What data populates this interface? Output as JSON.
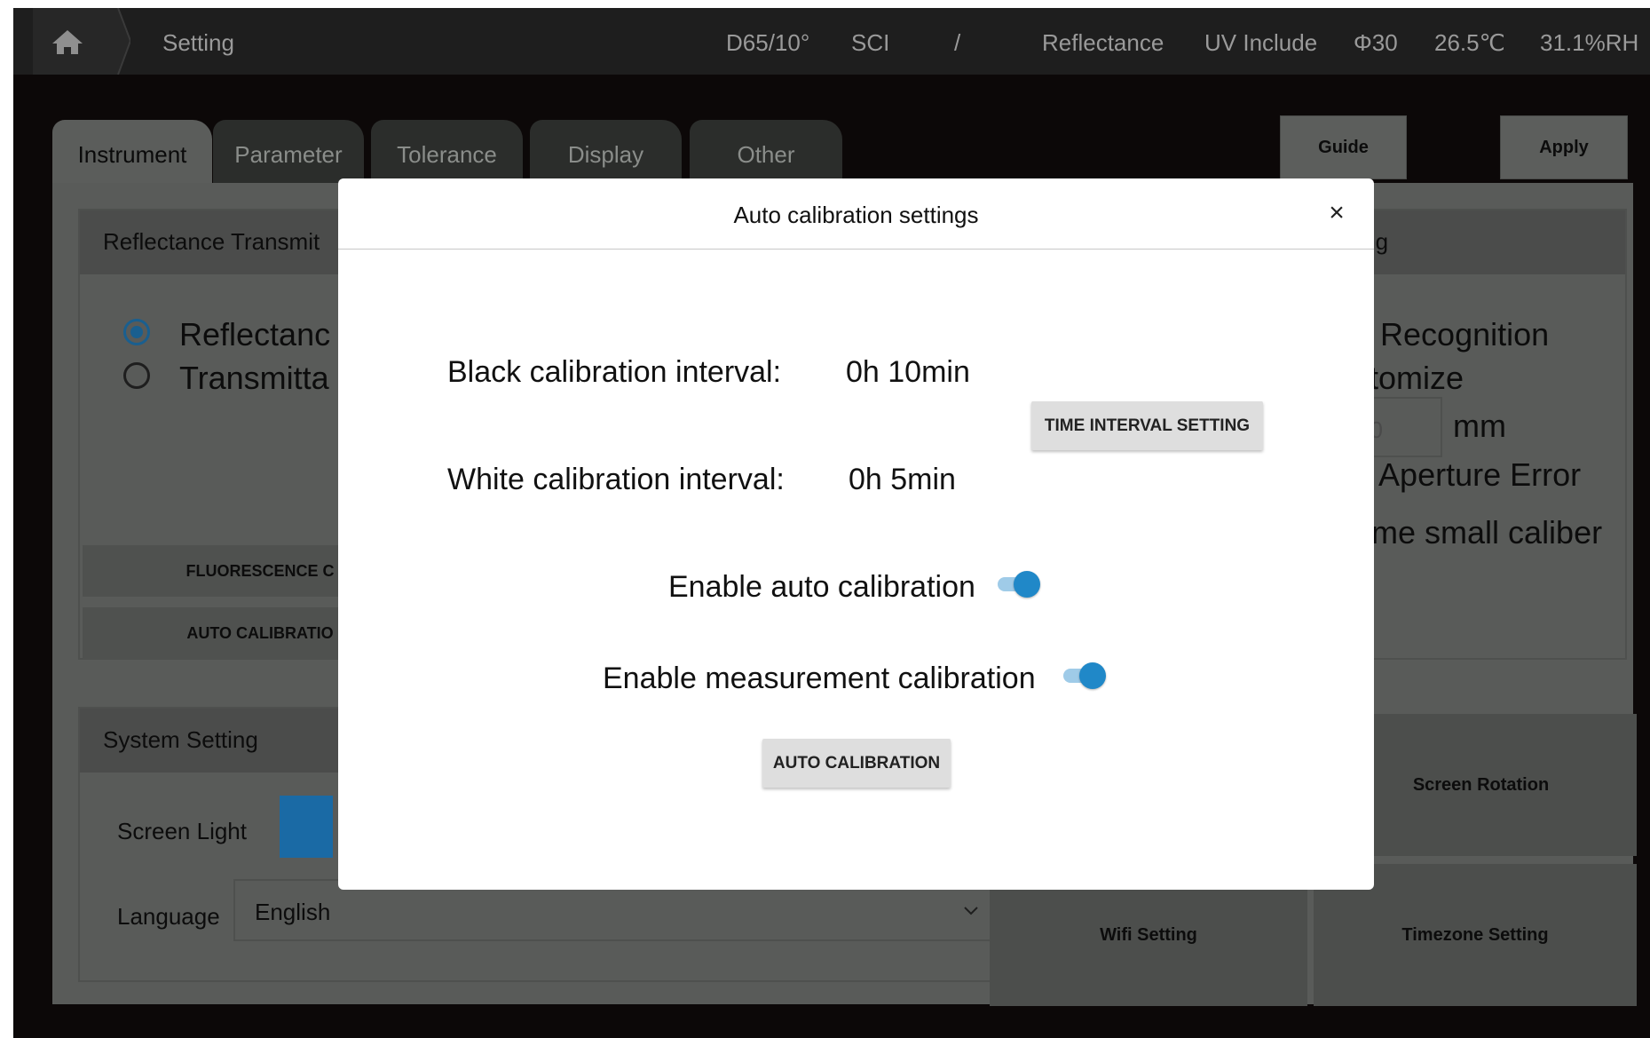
{
  "header": {
    "crumb": "Setting",
    "illuminant": "D65/10°",
    "mode": "SCI",
    "separator": "/",
    "measure_type": "Reflectance",
    "uv": "UV Include",
    "aperture": "Φ30",
    "temperature": "26.5℃",
    "humidity": "31.1%RH"
  },
  "tabs": [
    "Instrument",
    "Parameter",
    "Tolerance",
    "Display",
    "Other"
  ],
  "buttons": {
    "guide": "Guide",
    "apply": "Apply"
  },
  "background": {
    "reflectance_box_title": "Reflectance Transmit",
    "radio_reflectance": "Reflectanc",
    "radio_transmittance": "Transmitta",
    "fluorescence_btn": "FLUORESCENCE C",
    "auto_calibration_btn": "AUTO CALIBRATIO",
    "right_box_title": "tting",
    "auto_recognition": "o Recognition",
    "customize": "stomize",
    "aperture_input": "30",
    "unit_mm": "mm",
    "aperture_error": "e Aperture Error",
    "small_caliber": "ome small caliber",
    "system_setting_title": "System Setting",
    "screen_light_label": "Screen Light",
    "language_label": "Language",
    "language_value": "English",
    "screen_rotation": "Screen Rotation",
    "wifi_setting": "Wifi Setting",
    "timezone_setting": "Timezone Setting"
  },
  "dialog": {
    "title": "Auto calibration settings",
    "close": "×",
    "black_label": "Black calibration interval:",
    "black_value": "0h 10min",
    "white_label": "White calibration interval:",
    "white_value": "0h 5min",
    "time_interval_btn": "TIME INTERVAL SETTING",
    "enable_auto_label": "Enable auto calibration",
    "enable_auto_on": true,
    "enable_measure_label": "Enable measurement calibration",
    "enable_measure_on": true,
    "auto_calibration_btn": "AUTO CALIBRATION"
  },
  "colors": {
    "accent": "#2088c8",
    "switch_track": "#9fcbe8",
    "screen_light_slider": "#1a6aa5"
  }
}
